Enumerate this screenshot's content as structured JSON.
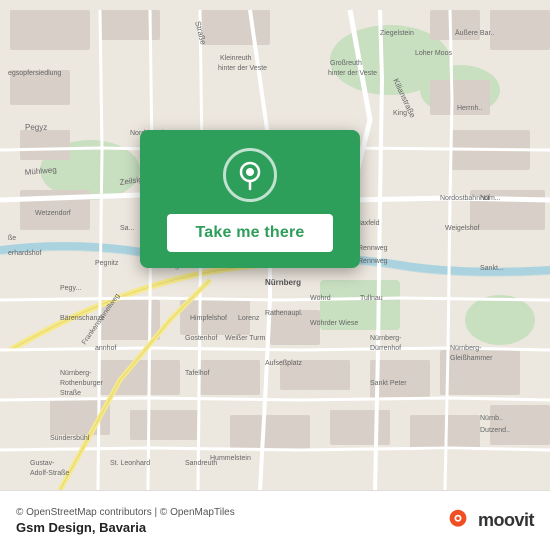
{
  "map": {
    "attribution": "© OpenStreetMap contributors | © OpenMapTiles",
    "location_label": "Gsm Design, Bavaria",
    "center_lat": 49.45,
    "center_lon": 11.08
  },
  "card": {
    "button_label": "Take me there"
  },
  "branding": {
    "name": "moovit"
  },
  "colors": {
    "green": "#2e9e5b",
    "road": "#ffffff",
    "road_secondary": "#f5e9b0",
    "green_area": "#b8dcb0",
    "water": "#aad3df",
    "land": "#e8e0d8",
    "urban": "#d0c8bf"
  }
}
